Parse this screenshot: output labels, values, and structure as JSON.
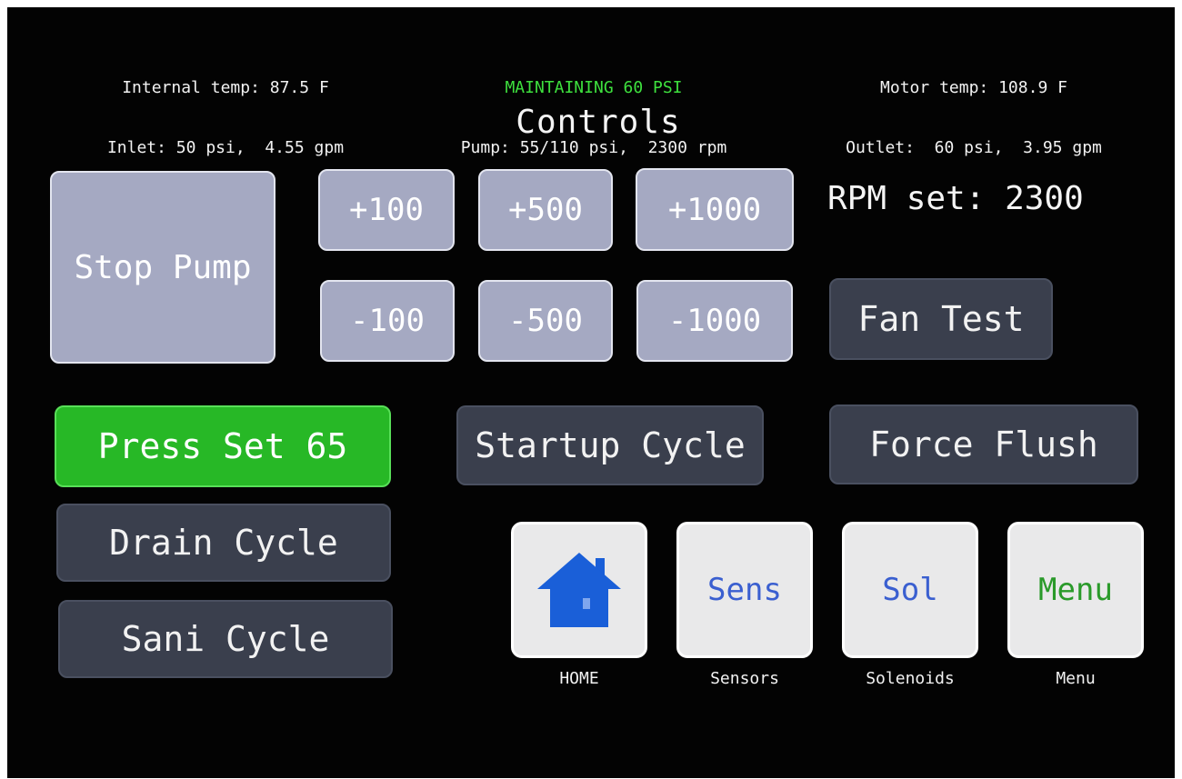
{
  "status": {
    "left": {
      "line1": "Internal temp: 87.5 F",
      "line2": "Inlet: 50 psi,  4.55 gpm"
    },
    "middle": {
      "line1": "MAINTAINING 60 PSI",
      "line2": "Pump: 55/110 psi,  2300 rpm"
    },
    "right": {
      "line1": "Motor temp: 108.9 F",
      "line2": "Outlet:  60 psi,  3.95 gpm"
    }
  },
  "title": "Controls",
  "controls": {
    "stop_pump": "Stop Pump",
    "plus_100": "+100",
    "plus_500": "+500",
    "plus_1000": "+1000",
    "minus_100": "-100",
    "minus_500": "-500",
    "minus_1000": "-1000",
    "rpm_set": "RPM set: 2300",
    "fan_test": "Fan Test",
    "press_set": "Press Set 65",
    "startup_cycle": "Startup Cycle",
    "force_flush": "Force Flush",
    "drain_cycle": "Drain Cycle",
    "sani_cycle": "Sani Cycle"
  },
  "nav": {
    "home": {
      "icon": "home-icon",
      "label": "HOME"
    },
    "sensors": {
      "text": "Sens",
      "label": "Sensors"
    },
    "solenoids": {
      "text": "Sol",
      "label": "Solenoids"
    },
    "menu": {
      "text": "Menu",
      "label": "Menu"
    }
  },
  "colors": {
    "screen_bg": "#030303",
    "status_green": "#3ee03e",
    "button_gray": "#a5a9c2",
    "button_dark": "#3a3f4d",
    "button_green": "#27b826",
    "home_icon_blue": "#1a5fd8",
    "nav_text_blue": "#3a5fd0",
    "nav_text_green": "#2a9a2a"
  }
}
